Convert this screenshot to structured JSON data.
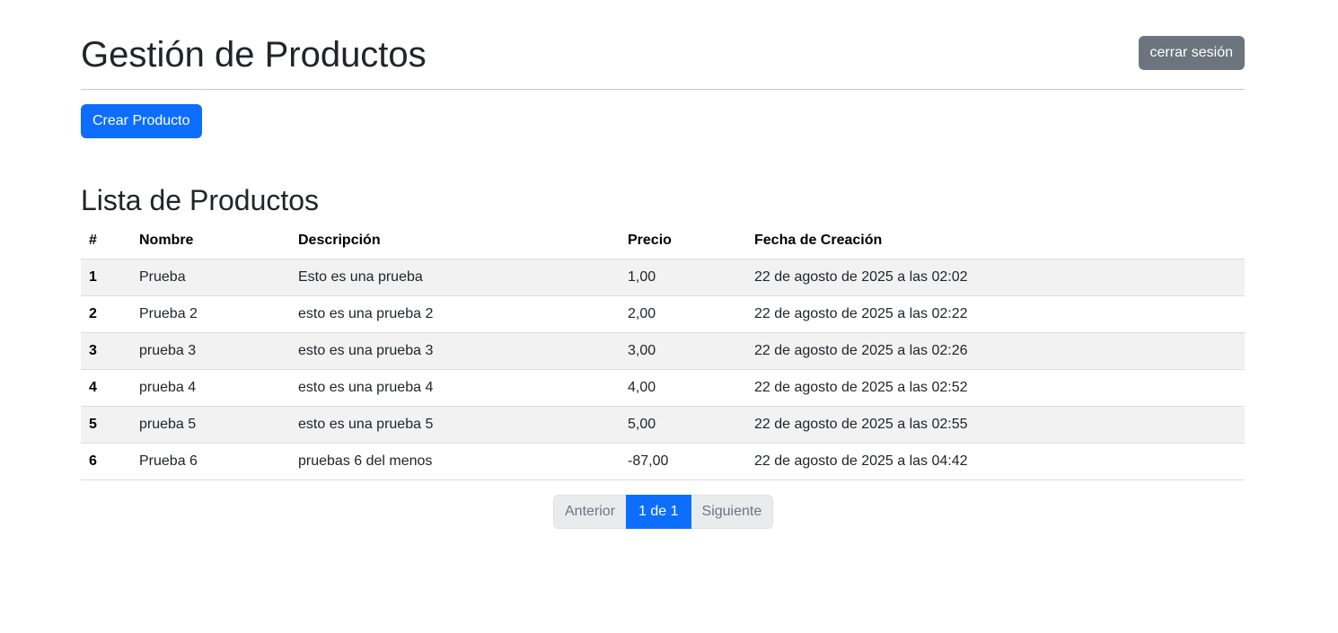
{
  "header": {
    "title": "Gestión de Productos",
    "logout_label": "cerrar sesión"
  },
  "actions": {
    "create_label": "Crear Producto"
  },
  "list": {
    "title": "Lista de Productos",
    "columns": [
      "#",
      "Nombre",
      "Descripción",
      "Precio",
      "Fecha de Creación"
    ],
    "rows": [
      {
        "num": "1",
        "name": "Prueba",
        "description": "Esto es una prueba",
        "price": "1,00",
        "date": "22 de agosto de 2025 a las 02:02"
      },
      {
        "num": "2",
        "name": "Prueba 2",
        "description": "esto es una prueba 2",
        "price": "2,00",
        "date": "22 de agosto de 2025 a las 02:22"
      },
      {
        "num": "3",
        "name": "prueba 3",
        "description": "esto es una prueba 3",
        "price": "3,00",
        "date": "22 de agosto de 2025 a las 02:26"
      },
      {
        "num": "4",
        "name": "prueba 4",
        "description": "esto es una prueba 4",
        "price": "4,00",
        "date": "22 de agosto de 2025 a las 02:52"
      },
      {
        "num": "5",
        "name": "prueba 5",
        "description": "esto es una prueba 5",
        "price": "5,00",
        "date": "22 de agosto de 2025 a las 02:55"
      },
      {
        "num": "6",
        "name": "Prueba 6",
        "description": "pruebas 6 del menos",
        "price": "-87,00",
        "date": "22 de agosto de 2025 a las 04:42"
      }
    ]
  },
  "pagination": {
    "prev_label": "Anterior",
    "current_label": "1 de 1",
    "next_label": "Siguiente"
  },
  "colors": {
    "primary": "#0d6efd",
    "secondary": "#6c757d",
    "striped_row": "#f2f2f2"
  }
}
